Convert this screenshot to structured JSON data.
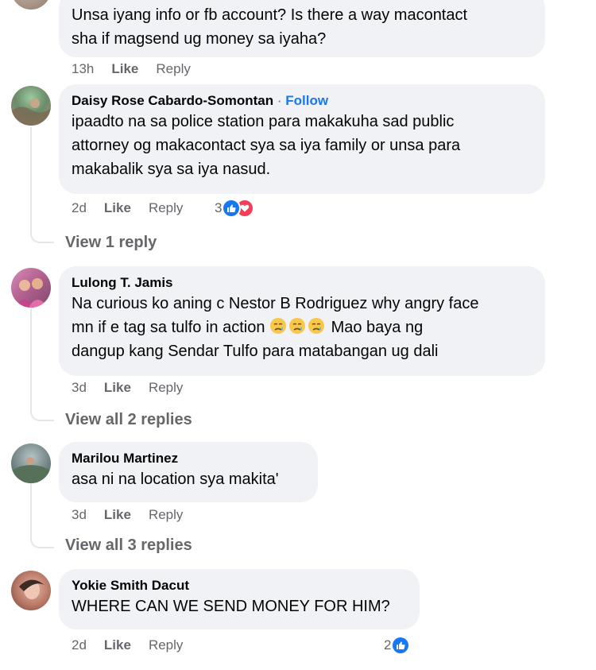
{
  "comments": [
    {
      "author": "",
      "text_lines": [
        "Unsa iyang info or fb account? Is there a way macontact",
        "sha if magsend ug money sa iyaha?"
      ],
      "time": "13h",
      "like_label": "Like",
      "reply_label": "Reply"
    },
    {
      "author": "Daisy Rose Cabardo-Somontan",
      "separator": "·",
      "follow_label": "Follow",
      "text_lines": [
        "ipaadto na sa police station para makakuha sad public",
        "attorney og makacontact sya sa iya family or unsa para",
        "makabalik sya sa iya nasud."
      ],
      "time": "2d",
      "like_label": "Like",
      "reply_label": "Reply",
      "reaction_count": "3",
      "reactions": [
        "like-icon",
        "love-icon"
      ],
      "view_replies": "View 1 reply"
    },
    {
      "author": "Lulong T. Jamis",
      "text_lines": [
        "Na curious ko aning c Nestor B Rodriguez why angry face",
        "mn if e tag sa tulfo in action",
        "dangup kang Sendar Tulfo para matabangan ug dali"
      ],
      "text_line2_tail": " Mao baya ng",
      "emojis": [
        "disappointed-relieved-emoji",
        "disappointed-relieved-emoji",
        "disappointed-relieved-emoji"
      ],
      "time": "3d",
      "like_label": "Like",
      "reply_label": "Reply",
      "view_replies": "View all 2 replies"
    },
    {
      "author": "Marilou Martinez",
      "text_lines": [
        "asa ni na location sya makita'"
      ],
      "time": "3d",
      "like_label": "Like",
      "reply_label": "Reply",
      "view_replies": "View all 3 replies"
    },
    {
      "author": "Yokie Smith Dacut",
      "text_lines": [
        "WHERE CAN WE SEND MONEY FOR HIM?"
      ],
      "time": "2d",
      "like_label": "Like",
      "reply_label": "Reply",
      "reaction_count": "2",
      "reactions": [
        "like-icon"
      ]
    }
  ],
  "colors": {
    "bubble": "#f0f2f5",
    "secondary_text": "#65676b",
    "link_blue": "#1877f2",
    "love_red": "#f33e58",
    "thread_line": "#e4e6eb"
  }
}
